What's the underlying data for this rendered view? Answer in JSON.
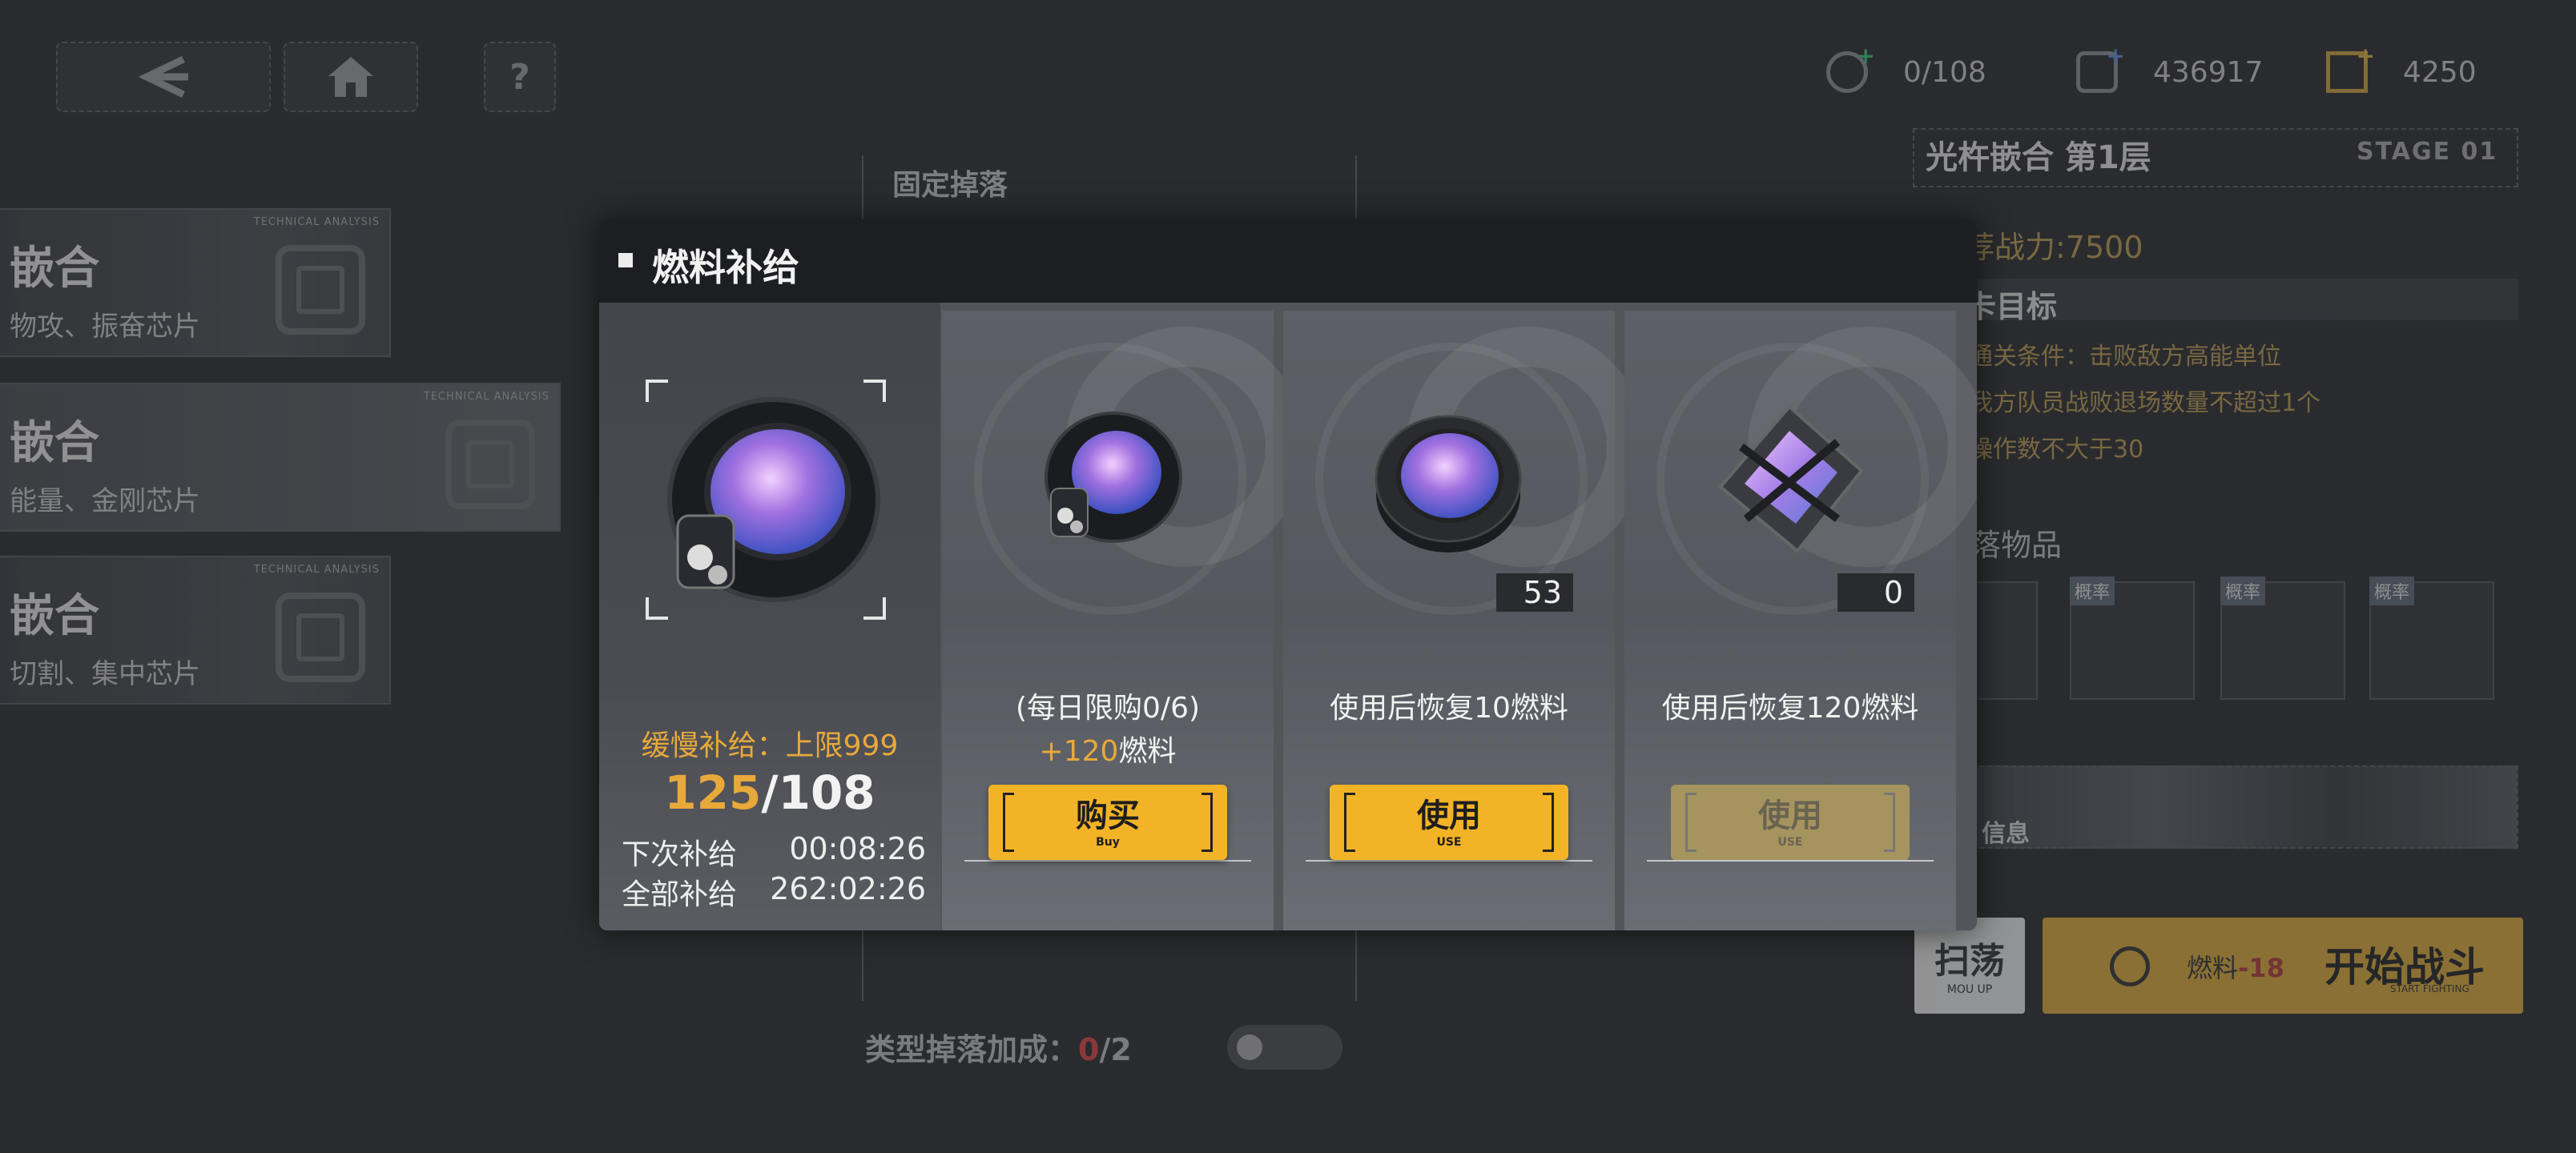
{
  "top_bar": {
    "resources": [
      {
        "icon": "energy-icon",
        "value": "0/108",
        "plus_color": "#3bbf7a"
      },
      {
        "icon": "credits-icon",
        "value": "436917",
        "plus_color": "#5b8cd9"
      },
      {
        "icon": "fuel-icon",
        "value": "4250",
        "plus_color": "#e0b040"
      }
    ]
  },
  "stage_list": [
    {
      "title": "嵌合",
      "subtitle": "物攻、振奋芯片",
      "tag": "TECHNICAL ANALYSIS"
    },
    {
      "title": "嵌合",
      "subtitle": "能量、金刚芯片",
      "tag": "TECHNICAL ANALYSIS"
    },
    {
      "title": "嵌合",
      "subtitle": "切割、集中芯片",
      "tag": "TECHNICAL ANALYSIS"
    }
  ],
  "middle": {
    "fixed_drops_title": "固定掉落",
    "bonus_label": "类型掉落加成：",
    "bonus_current": "0",
    "bonus_total": "/2"
  },
  "right_panel": {
    "stage_title": "光杵嵌合 第1层",
    "stage_tag": "STAGE 01",
    "power": "荐战力:7500",
    "goals_header": "卡目标",
    "goals": [
      "通关条件：击败敌方高能单位",
      "我方队员战败退场数量不超过1个",
      "操作数不大于30"
    ],
    "drops_title": "落物品",
    "probability_label": "概率",
    "info_label": "信息",
    "sweep_label": "扫荡",
    "sweep_en": "MOU UP",
    "fuel_label": "燃料",
    "fuel_cost": "-18",
    "start_label": "开始战斗",
    "start_en": "START FIGHTING"
  },
  "modal": {
    "title": "燃料补给",
    "slow_supply": "缓慢补给：上限999",
    "current": "125",
    "max": "/108",
    "next_label": "下次补给",
    "next_time": "00:08:26",
    "all_label": "全部补给",
    "all_time": "262:02:26",
    "cards": [
      {
        "desc_line1": "(每日限购0/6)",
        "desc_bonus": "+120",
        "desc_suffix": "燃料",
        "qty": "",
        "button": "购买",
        "button_en": "Buy",
        "enabled": true
      },
      {
        "desc_line1": "使用后恢复10燃料",
        "desc_bonus": "",
        "desc_suffix": "",
        "qty": "53",
        "button": "使用",
        "button_en": "USE",
        "enabled": true
      },
      {
        "desc_line1": "使用后恢复120燃料",
        "desc_bonus": "",
        "desc_suffix": "",
        "qty": "0",
        "button": "使用",
        "button_en": "USE",
        "enabled": false
      }
    ]
  },
  "colors": {
    "accent": "#f2b326",
    "orange_text": "#e8a93a",
    "modal_header": "#1d1e21"
  }
}
